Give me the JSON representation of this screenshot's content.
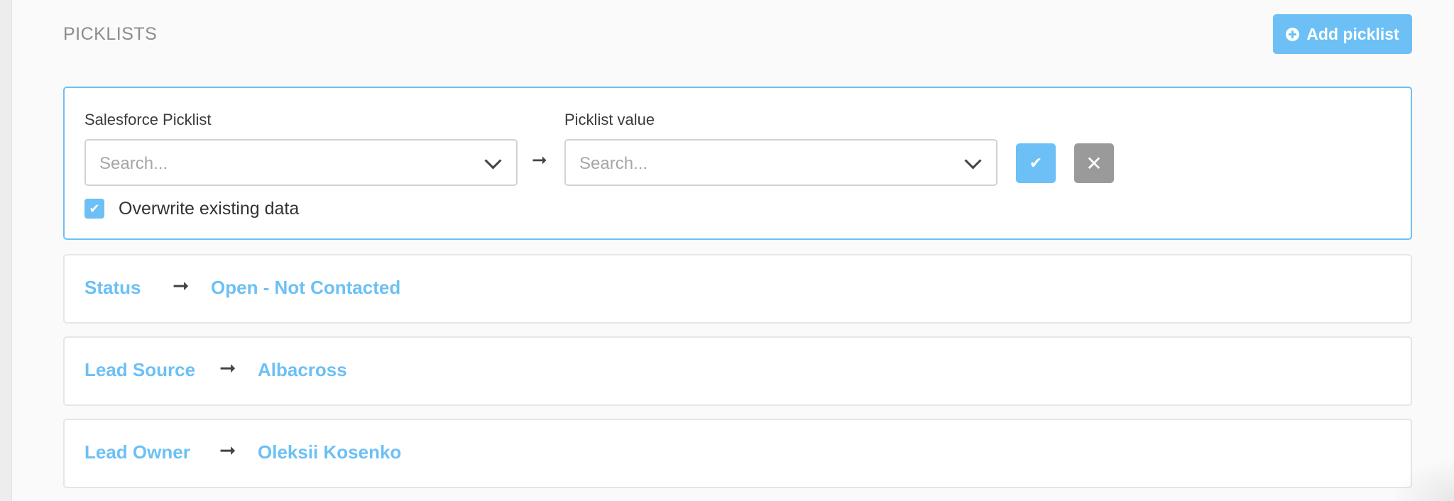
{
  "section": {
    "title": "PICKLISTS",
    "add_button_label": "Add picklist",
    "add_icon": "plus-circle-icon"
  },
  "editor": {
    "salesforce_label": "Salesforce Picklist",
    "salesforce_placeholder": "Search...",
    "value_label": "Picklist value",
    "value_placeholder": "Search...",
    "arrow": "➞",
    "confirm_icon": "✔",
    "cancel_icon": "✕",
    "overwrite_checked": true,
    "overwrite_label": "Overwrite existing data",
    "check_mark": "✔"
  },
  "mappings": [
    {
      "field": "Status",
      "arrow": "➞",
      "value": "Open - Not Contacted"
    },
    {
      "field": "Lead Source",
      "arrow": "➞",
      "value": "Albacross"
    },
    {
      "field": "Lead Owner",
      "arrow": "➞",
      "value": "Oleksii Kosenko"
    }
  ],
  "colors": {
    "accent": "#6cc0f5",
    "cancel": "#9a9a9a",
    "text": "#333333",
    "muted": "#8c8c8c"
  }
}
